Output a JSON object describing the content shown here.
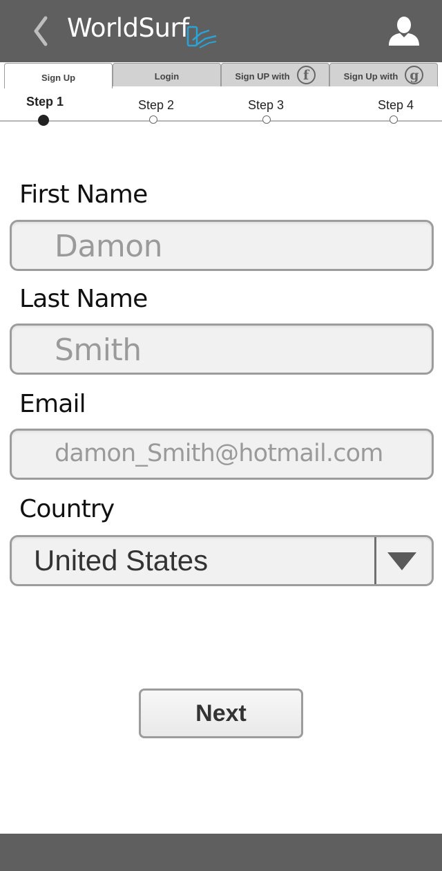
{
  "header": {
    "back_icon": "chevron-left-icon",
    "brand": "WorldSurf",
    "user_icon": "user-icon"
  },
  "tabs": [
    {
      "label": "Sign Up",
      "active": true
    },
    {
      "label": "Login",
      "active": false
    },
    {
      "label": "Sign UP with",
      "icon": "facebook-icon",
      "glyph": "f",
      "active": false
    },
    {
      "label": "Sign Up with",
      "icon": "google-icon",
      "glyph": "g",
      "active": false
    }
  ],
  "steps": [
    {
      "label": "Step 1",
      "current": true
    },
    {
      "label": "Step 2",
      "current": false
    },
    {
      "label": "Step 3",
      "current": false
    },
    {
      "label": "Step 4",
      "current": false
    }
  ],
  "form": {
    "first_name": {
      "label": "First Name",
      "value": "Damon"
    },
    "last_name": {
      "label": "Last Name",
      "value": "Smith"
    },
    "email": {
      "label": "Email",
      "value": "damon_Smith@hotmail.com"
    },
    "country": {
      "label": "Country",
      "value": "United States"
    }
  },
  "actions": {
    "next_label": "Next"
  },
  "colors": {
    "header_bg": "#5f5f5f",
    "field_bg": "#f1f1f1",
    "field_border": "#9c9c9c",
    "logo_accent": "#29a3d8"
  }
}
